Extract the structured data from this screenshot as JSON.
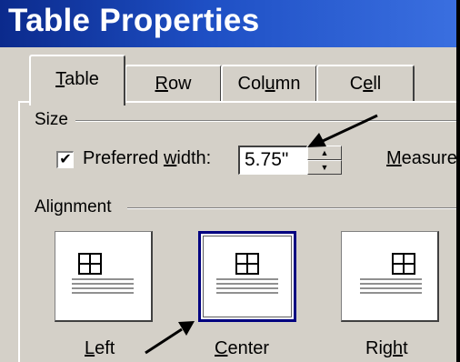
{
  "window": {
    "title": "Table Properties"
  },
  "tabs": [
    {
      "label_underlined": "T",
      "label_rest": "able",
      "selected": true
    },
    {
      "label_underlined": "R",
      "label_rest": "ow",
      "selected": false
    },
    {
      "label_prefix": "Col",
      "label_underlined": "u",
      "label_rest": "mn",
      "selected": false
    },
    {
      "label_prefix": "C",
      "label_underlined": "e",
      "label_rest": "ll",
      "selected": false
    }
  ],
  "size": {
    "group_label": "Size",
    "preferred_width": {
      "checked": true,
      "check_glyph": "✔",
      "label_prefix": "Preferred ",
      "label_underlined": "w",
      "label_rest": "idth:",
      "value": "5.75\""
    },
    "measure": {
      "label_underlined": "M",
      "label_rest": "easure"
    }
  },
  "alignment": {
    "group_label": "Alignment",
    "selected": "Center",
    "options": [
      {
        "label_underlined": "L",
        "label_rest": "eft"
      },
      {
        "label_underlined": "C",
        "label_rest": "enter"
      },
      {
        "label_prefix": "Rig",
        "label_underlined": "h",
        "label_rest": "t"
      }
    ]
  },
  "colors": {
    "title_bar": "#1e4fc4",
    "window_face": "#d4d0c8",
    "selected_border": "#000080",
    "annotation_arrow": "#000000"
  },
  "icons": {
    "spin_up": "triangle-up-icon",
    "spin_down": "triangle-down-icon",
    "table_align": "table-grid-icon"
  }
}
